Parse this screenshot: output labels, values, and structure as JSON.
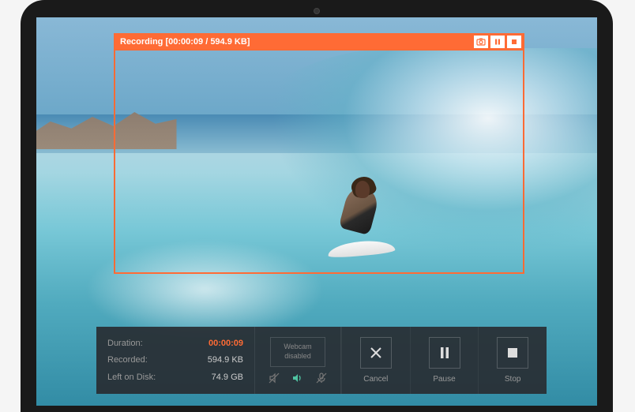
{
  "colors": {
    "accent": "#ff6b35",
    "panel_bg": "rgba(40,44,50,0.92)"
  },
  "capture": {
    "status_label": "Recording",
    "time": "00:00:09",
    "size": "594.9 KB",
    "header_text": "Recording [00:00:09 / 594.9 KB]"
  },
  "stats": {
    "duration_label": "Duration:",
    "duration_value": "00:00:09",
    "recorded_label": "Recorded:",
    "recorded_value": "594.9 KB",
    "disk_label": "Left on Disk:",
    "disk_value": "74.9 GB"
  },
  "webcam": {
    "line1": "Webcam",
    "line2": "disabled"
  },
  "actions": {
    "cancel": "Cancel",
    "pause": "Pause",
    "stop": "Stop"
  },
  "icons": {
    "camera": "camera-icon",
    "pause_small": "pause-icon",
    "stop_small": "stop-icon",
    "system_audio": "system-audio-icon",
    "speaker": "speaker-icon",
    "mic": "microphone-icon"
  }
}
